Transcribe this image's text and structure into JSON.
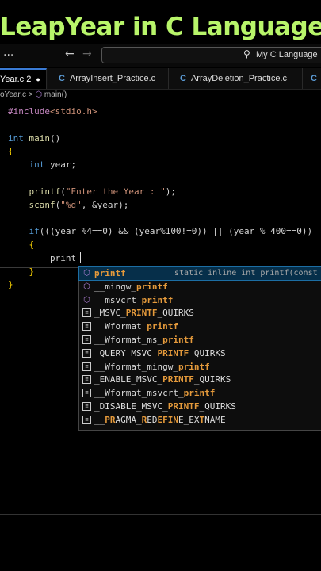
{
  "banner": {
    "title": "LeapYear in C Language"
  },
  "titlebar": {
    "menu": "...",
    "back": "←",
    "forward": "→",
    "search_icon": "search-icon",
    "search_text": "My C Language"
  },
  "tabs": [
    {
      "label": "Year.c 2",
      "active": true,
      "modified": true
    },
    {
      "label": "ArrayInsert_Practice.c",
      "active": false
    },
    {
      "label": "ArrayDeletion_Practice.c",
      "active": false
    },
    {
      "label": "",
      "active": false
    }
  ],
  "breadcrumb": {
    "file": "oYear.c",
    "sep": ">",
    "symbol": "main()"
  },
  "code_lines": [
    "#include<stdio.h>",
    "",
    "int main()",
    "{",
    "    int year;",
    "",
    "    printf(\"Enter the Year : \");",
    "    scanf(\"%d\", &year);",
    "",
    "    if(((year %4==0) && (year%100!=0)) || (year % 400==0))",
    "    {",
    "        print",
    "    }",
    "}"
  ],
  "suggestions": [
    {
      "label": "printf",
      "pre": "",
      "match": "printf",
      "post": "",
      "icon": "cube-icon",
      "selected": true,
      "detail": "static inline int printf(const c"
    },
    {
      "label": "__mingw_printf",
      "pre": "__mingw_",
      "match": "printf",
      "post": "",
      "icon": "cube-icon"
    },
    {
      "label": "__msvcrt_printf",
      "pre": "__msvcrt_",
      "match": "printf",
      "post": "",
      "icon": "cube-icon"
    },
    {
      "label": "_MSVC_PRINTF_QUIRKS",
      "pre": "_MSVC_",
      "match": "PRINTF",
      "post": "_QUIRKS",
      "icon": "keyword-icon"
    },
    {
      "label": "__Wformat_printf",
      "pre": "__Wformat_",
      "match": "printf",
      "post": "",
      "icon": "keyword-icon"
    },
    {
      "label": "__Wformat_ms_printf",
      "pre": "__Wformat_ms_",
      "match": "printf",
      "post": "",
      "icon": "keyword-icon"
    },
    {
      "label": "_QUERY_MSVC_PRINTF_QUIRKS",
      "pre": "_QUERY_MSVC_",
      "match": "PRINTF",
      "post": "_QUIRKS",
      "icon": "keyword-icon"
    },
    {
      "label": "__Wformat_mingw_printf",
      "pre": "__Wformat_mingw_",
      "match": "printf",
      "post": "",
      "icon": "keyword-icon"
    },
    {
      "label": "_ENABLE_MSVC_PRINTF_QUIRKS",
      "pre": "_ENABLE_MSVC_",
      "match": "PRINTF",
      "post": "_QUIRKS",
      "icon": "keyword-icon"
    },
    {
      "label": "__Wformat_msvcrt_printf",
      "pre": "__Wformat_msvcrt_",
      "match": "printf",
      "post": "",
      "icon": "keyword-icon"
    },
    {
      "label": "_DISABLE_MSVC_PRINTF_QUIRKS",
      "pre": "_DISABLE_MSVC_",
      "match": "PRINTF",
      "post": "_QUIRKS",
      "icon": "keyword-icon"
    },
    {
      "label": "__PRAGMA_REDEFINE_EXTNAME",
      "pre": "__",
      "match": "PRAGMA_REDEFINE_EXTNAME",
      "post": "",
      "icon": "keyword-icon",
      "scattered": true
    }
  ],
  "colors": {
    "banner": "#b8f56a",
    "accent": "#3a7bd5",
    "highlight": "#e59a3b"
  }
}
